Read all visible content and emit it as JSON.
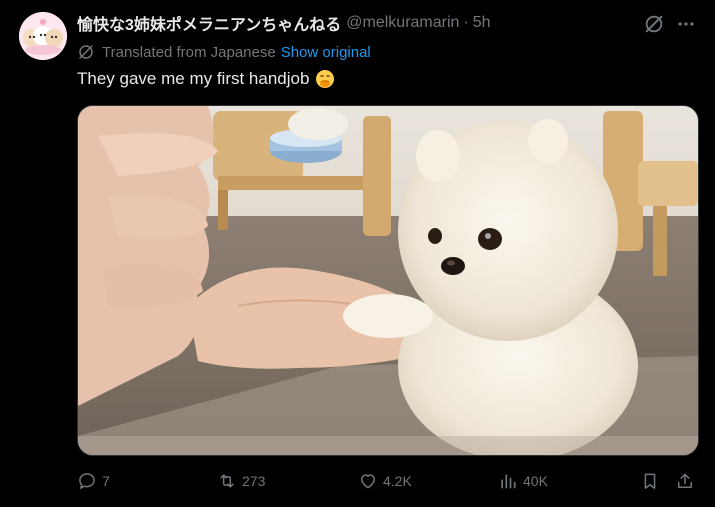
{
  "post": {
    "author": {
      "display_name": "愉快な3姉妹ポメラニアンちゃんねる",
      "handle": "@melkuramarin",
      "separator": "·",
      "time": "5h"
    },
    "translation": {
      "note": "Translated from Japanese",
      "show_original_label": "Show original"
    },
    "text": "They gave me my first handjob",
    "emoji_icon": "face-with-hand-over-mouth-emoji",
    "media": {
      "type": "image",
      "subject_icon": "pomeranian-puppy-photo"
    },
    "actions": {
      "replies": "7",
      "reposts": "273",
      "likes": "4.2K",
      "views": "40K"
    }
  },
  "colors": {
    "background": "#000000",
    "text_primary": "#e7e9ea",
    "text_secondary": "#71767b",
    "link": "#1d9bf0",
    "border": "#2f3336"
  }
}
